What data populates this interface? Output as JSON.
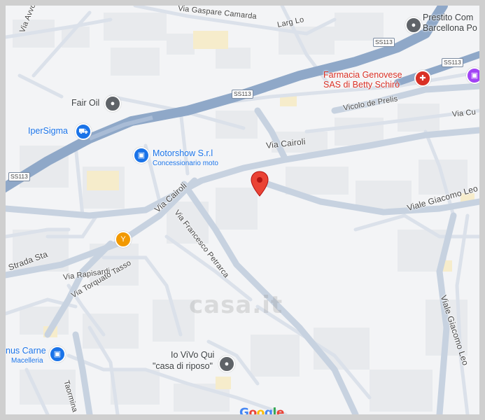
{
  "streets": {
    "via_gaspare_camarda": "Via Gaspare Camarda",
    "largo_lo": "Larg Lo",
    "via_avvocato": "Via Avvocato An",
    "vicolo_de_prelis": "Vicolo de Prelis",
    "via_cairoli_1": "Via Cairoli",
    "via_cairoli_2": "Via Cairoli",
    "viale_giacomo_leo_1": "Viale Giacomo Leo",
    "viale_giacomo_leo_2": "Viale Giacomo Leo",
    "via_cu": "Via Cu",
    "via_francesco_petrarca": "Via Francesco Petrarca",
    "strada_statale": "Strada Sta",
    "via_rapisardi": "Via Rapisardi",
    "via_torquato_tasso": "Via Torquato Tasso",
    "via_taormina": "Taormina"
  },
  "road_shields": {
    "ss113_top": "SS113",
    "ss113_mid": "SS113",
    "ss113_right": "SS113",
    "ss113_left": "SS113"
  },
  "pois": {
    "prestito_line1": "Prestito Com",
    "prestito_line2": "Barcellona Po",
    "farmacia_line1": "Farmacia Genovese",
    "farmacia_line2": "SAS di Betty Schirò",
    "fair_oil": "Fair Oil",
    "ipersigma": "IperSigma",
    "motorshow": "Motorshow S.r.l",
    "motorshow_sub": "Concessionario moto",
    "nus_carne": "nus Carne",
    "macelleria": "Macelleria",
    "io_vivo_line1": "Io ViVo Qui",
    "io_vivo_line2": "\"casa di riposo\""
  },
  "watermark": "casa.it",
  "google_logo": [
    "G",
    "o",
    "o",
    "g",
    "l",
    "e"
  ],
  "colors": {
    "highway": "#8fa8c8",
    "pin_red": "#ea4335",
    "poi_blue": "#1a73e8",
    "poi_orange": "#f29900",
    "poi_gray": "#5f6368",
    "poi_pink": "#d93025"
  },
  "icons": {
    "marker": "location-pin-icon",
    "fuel": "gas-station-icon",
    "cart": "shopping-cart-icon",
    "bag": "shopping-bag-icon",
    "bar": "cocktail-icon",
    "pharmacy": "pharmacy-icon",
    "circle": "place-icon"
  }
}
